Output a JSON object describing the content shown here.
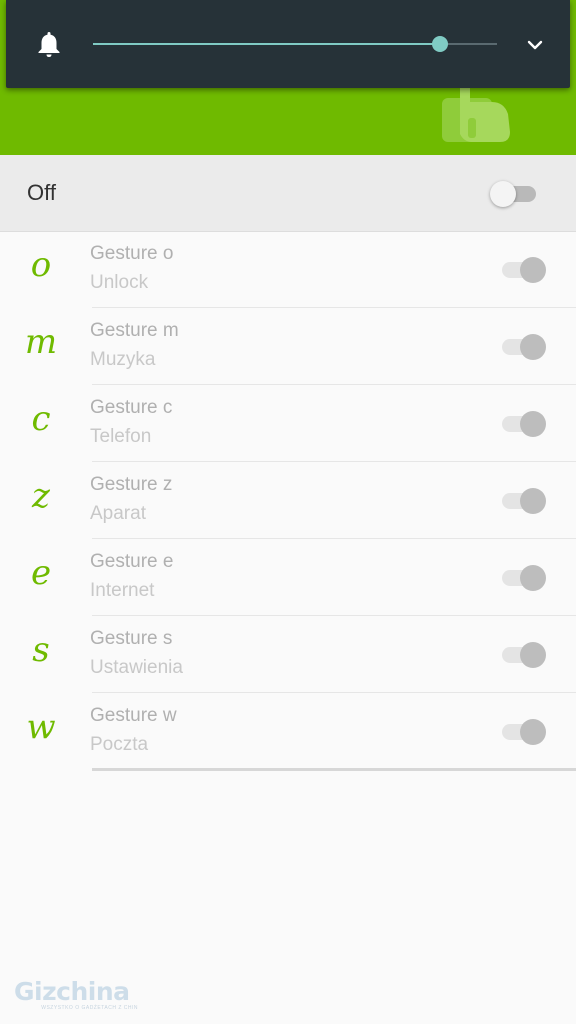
{
  "volume_panel": {
    "level": 0.86,
    "bell_icon": "bell-icon",
    "expand_icon": "chevron-down-icon",
    "colors": {
      "background": "#263238",
      "accent": "#80cbc4"
    }
  },
  "header": {
    "color": "#6fba00",
    "logo_icon": "hand-gesture-icon"
  },
  "master_switch": {
    "label": "Off",
    "state": "off"
  },
  "gestures": [
    {
      "glyph": "o",
      "name": "Gesture o",
      "action": "Unlock",
      "enabled": true
    },
    {
      "glyph": "m",
      "name": "Gesture m",
      "action": "Muzyka",
      "enabled": true
    },
    {
      "glyph": "c",
      "name": "Gesture c",
      "action": "Telefon",
      "enabled": true
    },
    {
      "glyph": "z",
      "name": "Gesture z",
      "action": "Aparat",
      "enabled": true
    },
    {
      "glyph": "e",
      "name": "Gesture e",
      "action": "Internet",
      "enabled": true
    },
    {
      "glyph": "s",
      "name": "Gesture s",
      "action": "Ustawienia",
      "enabled": true
    },
    {
      "glyph": "w",
      "name": "Gesture w",
      "action": "Poczta",
      "enabled": true
    }
  ],
  "watermark": {
    "logo": "Gizchina",
    "tagline": "WSZYSTKO O GADŻETACH Z CHIN"
  }
}
